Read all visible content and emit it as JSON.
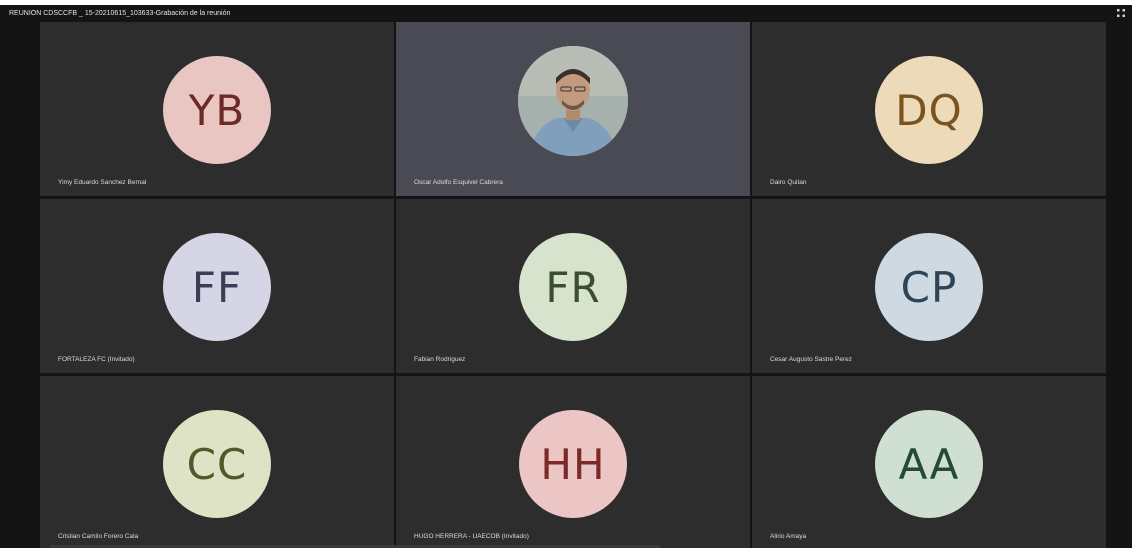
{
  "window": {
    "title": "REUNION CDSCCFB _ 15-20210615_103633-Grabación de la reunión"
  },
  "participants": [
    {
      "initials": "YB",
      "name": "Yimy Eduardo Sanchez Bernal",
      "bg": "#e9c6c2",
      "fg": "#6b2a26"
    },
    {
      "initials": "",
      "name": "Oscar Adolfo Esquivel Cabrera",
      "bg": "#9aa7a4",
      "fg": "#ffffff"
    },
    {
      "initials": "DQ",
      "name": "Dairo Quitan",
      "bg": "#ecdab8",
      "fg": "#7a5420"
    },
    {
      "initials": "FF",
      "name": "FORTALEZA FC (Invitado)",
      "bg": "#d6d5e6",
      "fg": "#3d3d58"
    },
    {
      "initials": "FR",
      "name": "Fabian Rodriguez",
      "bg": "#d7e3cc",
      "fg": "#3a4e30"
    },
    {
      "initials": "CP",
      "name": "Cesar Augusto Sastre Perez",
      "bg": "#cfd9e2",
      "fg": "#2e4454"
    },
    {
      "initials": "CC",
      "name": "Cristian Camilo Forero Cala",
      "bg": "#dde3c4",
      "fg": "#4f5a28"
    },
    {
      "initials": "HH",
      "name": "HUGO HERRERA - UAECOB (Invitado)",
      "bg": "#ebc6c4",
      "fg": "#7a2a28"
    },
    {
      "initials": "AA",
      "name": "Alirio Amaya",
      "bg": "#cfe0d3",
      "fg": "#244a33"
    }
  ],
  "colors": {
    "background": "#141414",
    "tile": "#2d2d2d",
    "active_tile": "#4a4a55"
  }
}
